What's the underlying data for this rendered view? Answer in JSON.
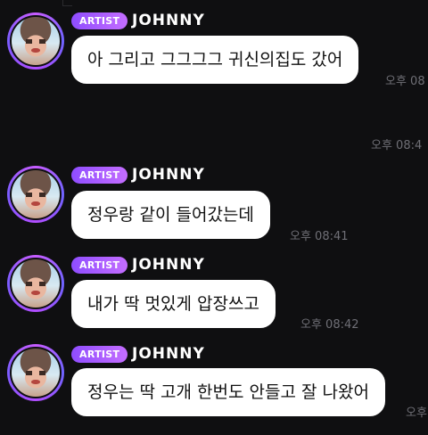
{
  "messages": [
    {
      "badge": "ARTIST",
      "name": "JOHNNY",
      "text": "아 그리고 그그그그 귀신의집도 갔어",
      "time": "오후 08"
    },
    {
      "badge": "ARTIST",
      "name": "JOHNNY",
      "text": "정우랑 같이 들어갔는데",
      "time": "오후 08:41"
    },
    {
      "badge": "ARTIST",
      "name": "JOHNNY",
      "text": "내가 딱 멋있게 압장쓰고",
      "time": "오후 08:42"
    },
    {
      "badge": "ARTIST",
      "name": "JOHNNY",
      "text": "정우는 딱 고개 한번도 안들고 잘 나왔어",
      "time": "오후"
    }
  ],
  "standalone_time": "오후 08:4"
}
